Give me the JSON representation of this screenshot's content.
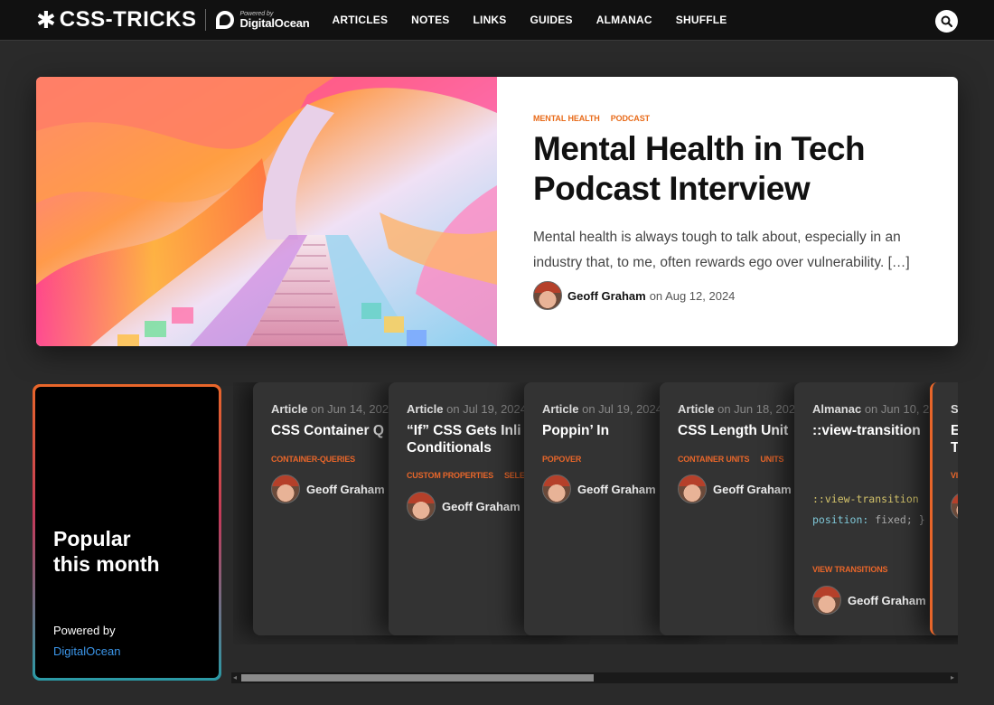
{
  "brand": {
    "name": "CSS-TRICKS",
    "powered": "Powered by",
    "sponsor": "DigitalOcean"
  },
  "nav": {
    "items": [
      "ARTICLES",
      "NOTES",
      "LINKS",
      "GUIDES",
      "ALMANAC",
      "SHUFFLE"
    ],
    "search_icon": "search-icon"
  },
  "hero": {
    "tags": [
      "MENTAL HEALTH",
      "PODCAST"
    ],
    "title": "Mental Health in Tech Podcast Interview",
    "excerpt": "Mental health is always tough to talk about, especially in an industry that, to me, often rewards ego over vulnerability. […]",
    "author": "Geoff Graham",
    "on": "on",
    "date": "Aug 12, 2024"
  },
  "popular": {
    "title": "Popular this month",
    "powered": "Powered by",
    "sponsor": "DigitalOcean"
  },
  "cards": [
    {
      "type": "Article",
      "date": "on Jun 14, 202",
      "title": "CSS Container Q",
      "tags": [
        "CONTAINER-QUERIES"
      ],
      "author": "Geoff Graham"
    },
    {
      "type": "Article",
      "date": "on Jul 19, 2024",
      "title": "“If” CSS Gets Inli Conditionals",
      "tags": [
        "CUSTOM PROPERTIES",
        "SELE"
      ],
      "author": "Geoff Graham"
    },
    {
      "type": "Article",
      "date": "on Jul 19, 2024",
      "title": "Poppin’ In",
      "tags": [
        "POPOVER"
      ],
      "author": "Geoff Graham"
    },
    {
      "type": "Article",
      "date": "on Jun 18, 202",
      "title": "CSS Length Unit",
      "tags": [
        "CONTAINER UNITS",
        "UNITS"
      ],
      "author": "Geoff Graham"
    },
    {
      "type": "Almanac",
      "date": "on Jun 10, 2",
      "title": "::view-transition",
      "tags": [
        "VIEW TRANSITIONS"
      ],
      "author": "Geoff Graham",
      "code": {
        "line1": "::view-transition",
        "line2_prop": "position:",
        "line2_val": " fixed; }"
      }
    },
    {
      "type": "S",
      "date": "",
      "title": "E T",
      "tags": [
        "VI"
      ],
      "author": ""
    }
  ],
  "colors": {
    "accent": "#e86b1a",
    "link": "#3b95e8",
    "background": "#2a2a2a"
  }
}
